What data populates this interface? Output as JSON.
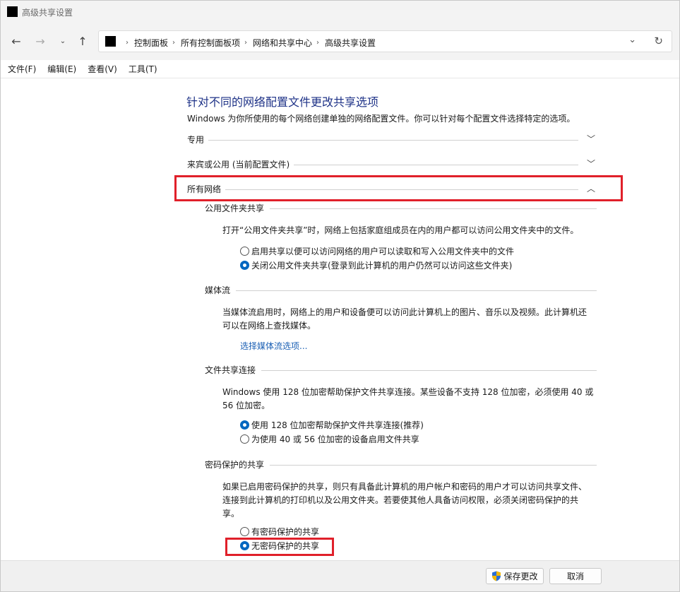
{
  "window": {
    "title": "高级共享设置"
  },
  "nav": {
    "back_icon": "arrow-left-icon",
    "forward_icon": "arrow-right-icon",
    "recent_icon": "chevron-down-icon",
    "up_icon": "arrow-up-icon",
    "breadcrumbs": [
      "控制面板",
      "所有控制面板项",
      "网络和共享中心",
      "高级共享设置"
    ]
  },
  "menu": {
    "items": [
      "文件(F)",
      "编辑(E)",
      "查看(V)",
      "工具(T)"
    ]
  },
  "main": {
    "heading": "针对不同的网络配置文件更改共享选项",
    "subtitle": "Windows 为你所使用的每个网络创建单独的网络配置文件。你可以针对每个配置文件选择特定的选项。",
    "profiles": [
      {
        "label": "专用",
        "expanded": false
      },
      {
        "label": "来宾或公用 (当前配置文件)",
        "expanded": false
      },
      {
        "label": "所有网络",
        "expanded": true
      }
    ],
    "public_folder": {
      "title": "公用文件夹共享",
      "desc": "打开“公用文件夹共享”时，网络上包括家庭组成员在内的用户都可以访问公用文件夹中的文件。",
      "options": [
        {
          "label": "启用共享以便可以访问网络的用户可以读取和写入公用文件夹中的文件",
          "checked": false
        },
        {
          "label": "关闭公用文件夹共享(登录到此计算机的用户仍然可以访问这些文件夹)",
          "checked": true
        }
      ]
    },
    "media_streaming": {
      "title": "媒体流",
      "desc_line1": "当媒体流启用时，网络上的用户和设备便可以访问此计算机上的图片、音乐以及视频。此计算机还",
      "desc_line2": "可以在网络上查找媒体。",
      "link": "选择媒体流选项..."
    },
    "file_sharing": {
      "title": "文件共享连接",
      "desc_line1": "Windows 使用 128 位加密帮助保护文件共享连接。某些设备不支持 128 位加密，必须使用 40 或",
      "desc_line2": "56 位加密。",
      "options": [
        {
          "label": "使用 128 位加密帮助保护文件共享连接(推荐)",
          "checked": true
        },
        {
          "label": "为使用 40 或 56 位加密的设备启用文件共享",
          "checked": false
        }
      ]
    },
    "password": {
      "title": "密码保护的共享",
      "desc_line1": "如果已启用密码保护的共享，则只有具备此计算机的用户帐户和密码的用户才可以访问共享文件、",
      "desc_line2": "连接到此计算机的打印机以及公用文件夹。若要使其他人具备访问权限，必须关闭密码保护的共",
      "desc_line3": "享。",
      "options": [
        {
          "label": "有密码保护的共享",
          "checked": false
        },
        {
          "label": "无密码保护的共享",
          "checked": true
        }
      ]
    }
  },
  "footer": {
    "save_label": "保存更改",
    "cancel_label": "取消",
    "shield_icon": "uac-shield-icon"
  },
  "colors": {
    "heading": "#1e3287",
    "link": "#1a5fb4",
    "highlight": "#e0202a",
    "radio_checked": "#0067c0"
  }
}
